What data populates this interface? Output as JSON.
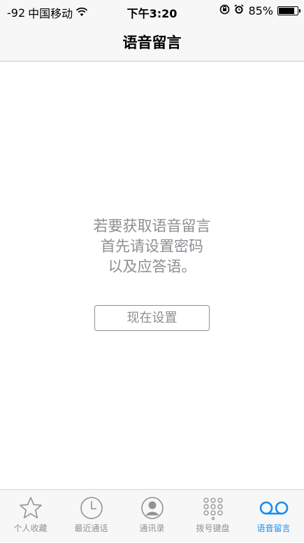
{
  "status_bar": {
    "signal": "-92",
    "carrier": "中国移动",
    "time": "下午3:20",
    "battery_percent": "85%",
    "battery_level": 0.85
  },
  "nav": {
    "title": "语音留言"
  },
  "main": {
    "message_lines": [
      "若要获取语音留言",
      "首先请设置密码",
      "以及应答语。"
    ],
    "setup_button": "现在设置"
  },
  "tabs": [
    {
      "label": "个人收藏",
      "icon": "star-icon",
      "active": false
    },
    {
      "label": "最近通话",
      "icon": "clock-icon",
      "active": false
    },
    {
      "label": "通讯录",
      "icon": "contacts-icon",
      "active": false
    },
    {
      "label": "拨号键盘",
      "icon": "keypad-icon",
      "active": false
    },
    {
      "label": "语音留言",
      "icon": "voicemail-icon",
      "active": true
    }
  ],
  "colors": {
    "accent": "#1a8cf0",
    "inactive": "#929292",
    "message": "#8e8e93"
  }
}
